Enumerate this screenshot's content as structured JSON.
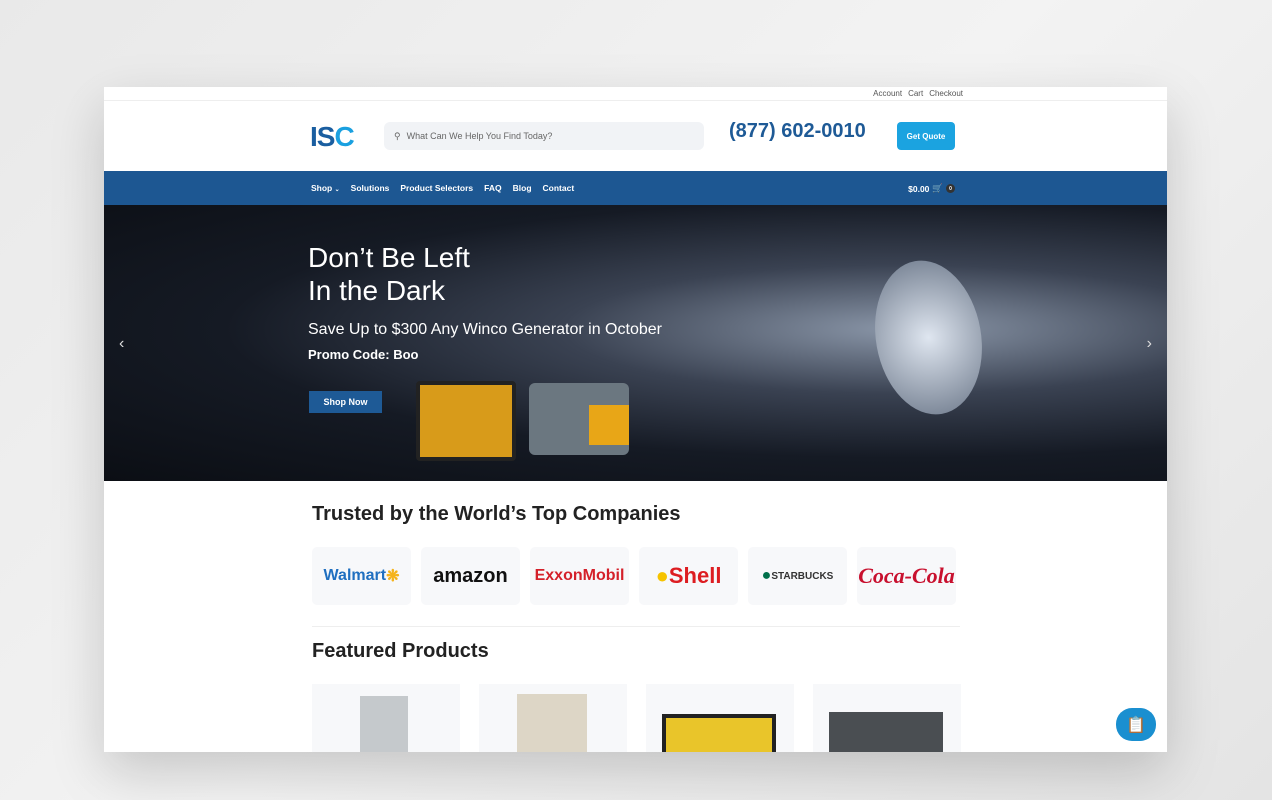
{
  "top_links": [
    "Account",
    "Cart",
    "Checkout"
  ],
  "logo": {
    "text_main": "IS",
    "text_accent": "C"
  },
  "search": {
    "placeholder": "What Can We Help You Find Today?"
  },
  "phone": "(877) 602-0010",
  "quote_label": "Get Quote",
  "nav": {
    "items": [
      "Shop",
      "Solutions",
      "Product Selectors",
      "FAQ",
      "Blog",
      "Contact"
    ],
    "cart_total": "$0.00",
    "cart_count": "0"
  },
  "hero": {
    "title_line1": "Don’t Be Left",
    "title_line2": "In the Dark",
    "subtitle": "Save Up to $300 Any Winco Generator in October",
    "promo": "Promo Code: Boo",
    "cta": "Shop Now"
  },
  "trusted": {
    "heading": "Trusted by the World’s Top Companies",
    "logos": [
      {
        "name": "Walmart",
        "color": "#1f6fc0"
      },
      {
        "name": "amazon",
        "color": "#111111"
      },
      {
        "name": "ExxonMobil",
        "color": "#d4202a"
      },
      {
        "name": "Shell",
        "color": "#dd1d21"
      },
      {
        "name": "STARBUCKS",
        "color": "#333333"
      },
      {
        "name": "Coca-Cola",
        "color": "#c8102e"
      }
    ]
  },
  "featured": {
    "heading": "Featured Products"
  },
  "colors": {
    "nav": "#1d5792",
    "accent": "#1ba3e0",
    "phone": "#1e5a96"
  }
}
